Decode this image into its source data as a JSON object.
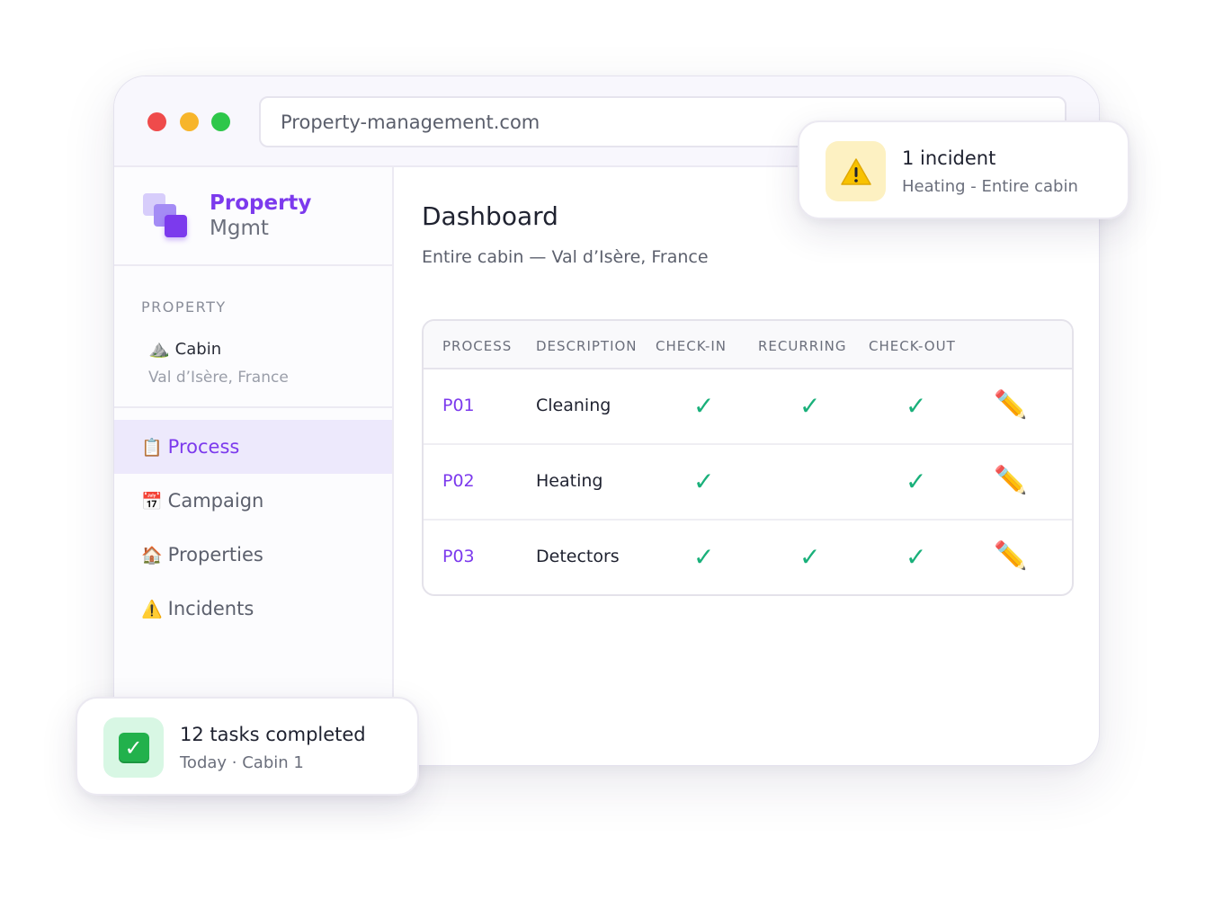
{
  "browser": {
    "url": "Property-management.com"
  },
  "brand": {
    "name": "Property",
    "sub": "Mgmt"
  },
  "property": {
    "section_label": "PROPERTY",
    "icon": "⛰️",
    "name": "Cabin",
    "location": "Val d’Isère, France"
  },
  "nav": {
    "items": [
      {
        "icon": "📋",
        "label": "Process",
        "active": true
      },
      {
        "icon": "📅",
        "label": "Campaign",
        "active": false
      },
      {
        "icon": "🏠",
        "label": "Properties",
        "active": false
      },
      {
        "icon": "⚠️",
        "label": "Incidents",
        "active": false
      }
    ]
  },
  "main": {
    "title": "Dashboard",
    "subtitle": "Entire cabin — Val d’Isère, France"
  },
  "table": {
    "headers": [
      "PROCESS",
      "DESCRIPTION",
      "CHECK-IN",
      "RECURRING",
      "CHECK-OUT"
    ],
    "check_glyph": "✓",
    "edit_glyph": "✏️",
    "check_color": "#19b07a",
    "rows": [
      {
        "id": "P01",
        "description": "Cleaning",
        "check_in": true,
        "recurring": true,
        "check_out": true
      },
      {
        "id": "P02",
        "description": "Heating",
        "check_in": true,
        "recurring": false,
        "check_out": true
      },
      {
        "id": "P03",
        "description": "Detectors",
        "check_in": true,
        "recurring": true,
        "check_out": true
      }
    ]
  },
  "notifications": {
    "incident": {
      "icon": "warning-icon",
      "title": "1 incident",
      "subtitle": "Heating - Entire cabin"
    },
    "tasks": {
      "icon": "check-mark-icon",
      "title": "12 tasks completed",
      "subtitle": "Today · Cabin 1"
    }
  },
  "colors": {
    "accent": "#7c3aed",
    "check": "#19b07a",
    "warning_bg": "#fdf1c2",
    "success_bg": "#d8f7e4"
  }
}
